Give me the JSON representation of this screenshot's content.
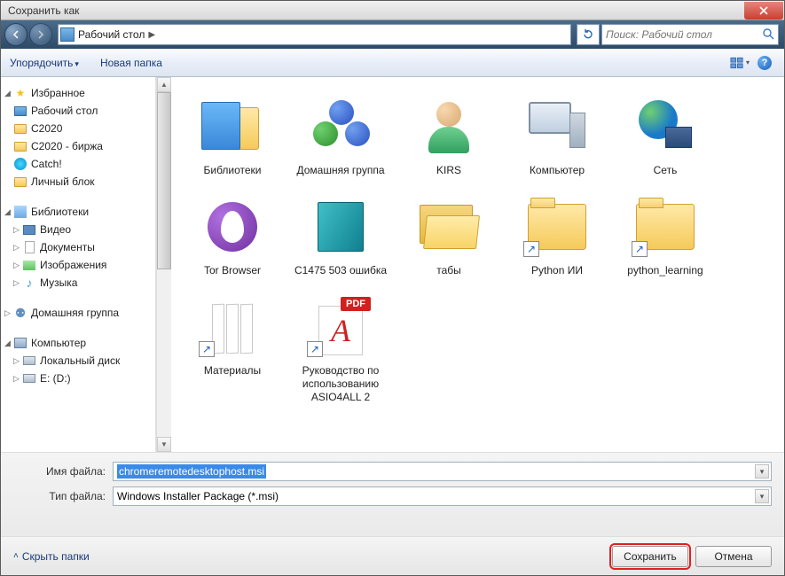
{
  "title": "Сохранить как",
  "nav": {
    "location": "Рабочий стол",
    "search_placeholder": "Поиск: Рабочий стол"
  },
  "toolbar": {
    "organize": "Упорядочить",
    "new_folder": "Новая папка"
  },
  "sidebar": {
    "favorites": {
      "header": "Избранное",
      "items": [
        "Рабочий стол",
        "C2020",
        "C2020 - биржа",
        "Catch!",
        "Личный блок"
      ]
    },
    "libraries": {
      "header": "Библиотеки",
      "items": [
        "Видео",
        "Документы",
        "Изображения",
        "Музыка"
      ]
    },
    "homegroup": {
      "header": "Домашняя группа"
    },
    "computer": {
      "header": "Компьютер",
      "items": [
        "Локальный диск",
        "E: (D:)"
      ]
    }
  },
  "items": [
    {
      "label": "Библиотеки",
      "icon": "libraries"
    },
    {
      "label": "Домашняя группа",
      "icon": "homegroup"
    },
    {
      "label": "KIRS",
      "icon": "user"
    },
    {
      "label": "Компьютер",
      "icon": "computer"
    },
    {
      "label": "Сеть",
      "icon": "network"
    },
    {
      "label": "Tor Browser",
      "icon": "tor"
    },
    {
      "label": "C1475 503 ошибка",
      "icon": "jewel"
    },
    {
      "label": "табы",
      "icon": "folder-open"
    },
    {
      "label": "Python ИИ",
      "icon": "folder-shortcut"
    },
    {
      "label": "python_learning",
      "icon": "folder-shortcut"
    },
    {
      "label": "Материалы",
      "icon": "docs-shortcut"
    },
    {
      "label": "Руководство по использованию ASIO4ALL 2",
      "icon": "pdf-shortcut"
    }
  ],
  "filename": {
    "label": "Имя файла:",
    "value": "chromeremotedesktophost.msi"
  },
  "filetype": {
    "label": "Тип файла:",
    "value": "Windows Installer Package (*.msi)"
  },
  "buttons": {
    "hide": "Скрыть папки",
    "save": "Сохранить",
    "cancel": "Отмена"
  },
  "pdf_badge": "PDF"
}
